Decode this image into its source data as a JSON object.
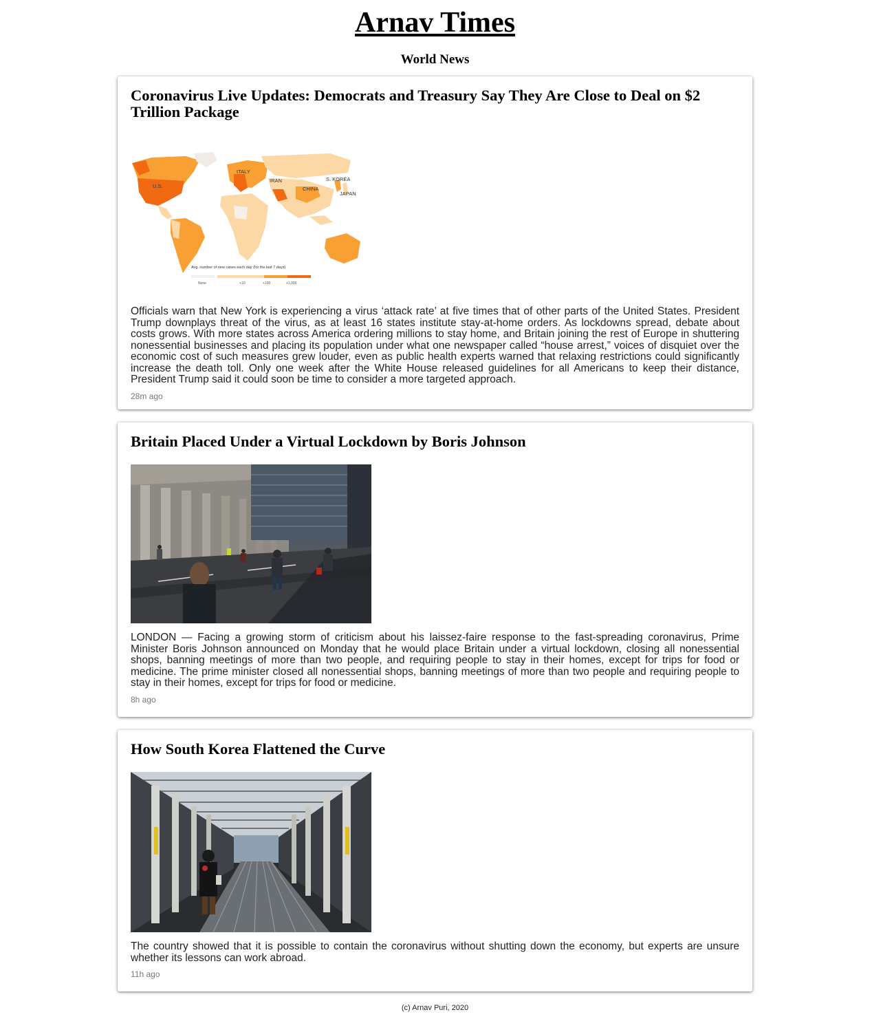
{
  "site": {
    "title": "Arnav Times",
    "section": "World News"
  },
  "articles": [
    {
      "headline": "Coronavirus Live Updates: Democrats and Treasury Say They Are Close to Deal on $2 Trillion Package",
      "map": {
        "labels": [
          "ITALY",
          "U.S.",
          "IRAN",
          "S. KOREA",
          "CHINA",
          "JAPAN"
        ],
        "legend_title": "Avg. number of new cases each day (for the last 7 days)",
        "legend_ticks": [
          "None",
          "+10",
          "+100",
          "+1,000"
        ],
        "colors": {
          "none": "#f0f0f0",
          "low": "#fbd8a6",
          "mid": "#f9a035",
          "high": "#f16a12"
        }
      },
      "summary": "Officials warn that New York is experiencing a virus ‘attack rate’ at five times that of other parts of the United States. President Trump downplays threat of the virus, as at least 16 states institute stay-at-home orders. As lockdowns spread, debate about costs grows. With more states across America ordering millions to stay home, and Britain joining the rest of Europe in shuttering nonessential businesses and placing its population under what one newspaper called “house arrest,” voices of disquiet over the economic cost of such measures grew louder, even as public health experts warned that relaxing restrictions could significantly increase the death toll. Only one week after the White House released guidelines for all Americans to keep their distance, President Trump said it could soon be time to consider a more targeted approach.",
      "time": "28m ago"
    },
    {
      "headline": "Britain Placed Under a Virtual Lockdown by Boris Johnson",
      "summary": "LONDON — Facing a growing storm of criticism about his laissez-faire response to the fast-spreading coronavirus, Prime Minister Boris Johnson announced on Monday that he would place Britain under a virtual lockdown, closing all nonessential shops, banning meetings of more than two people, and requiring people to stay in their homes, except for trips for food or medicine. The prime minister closed all nonessential shops, banning meetings of more than two people and requiring people to stay in their homes, except for trips for food or medicine.",
      "time": "8h ago"
    },
    {
      "headline": "How South Korea Flattened the Curve",
      "summary": "The country showed that it is possible to contain the coronavirus without shutting down the economy, but experts are unsure whether its lessons can work abroad.",
      "time": "11h ago"
    }
  ],
  "footer": "(c) Arnav Puri, 2020"
}
